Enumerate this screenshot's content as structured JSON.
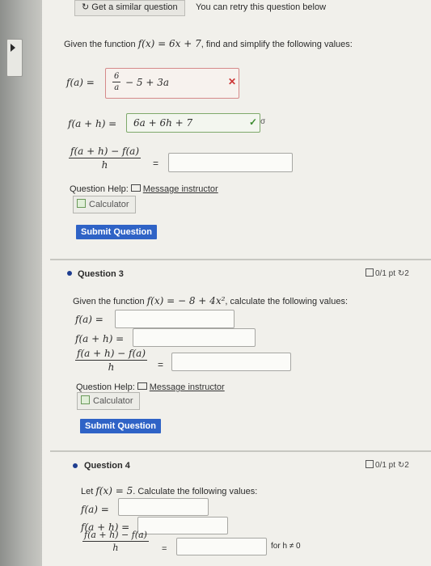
{
  "toolbar": {
    "similar_button": "Get a similar question",
    "retry_note": "You can retry this question below",
    "refresh_glyph": "↻"
  },
  "q2": {
    "prompt_pre": "Given the function",
    "fn": "f(x) = 6x + 7",
    "prompt_post": ", find and simplify the following values:",
    "r1_label": "f(a) =",
    "r1_answer": "− 5 + 3a",
    "r1_frac_num": "6",
    "r1_frac_den": "a",
    "r1_status_glyph": "✕",
    "r2_label": "f(a + h) =",
    "r2_answer": "6a + 6h + 7",
    "r2_status_glyph": "✓",
    "r2_key_glyph": "σ",
    "r3_num": "f(a + h) − f(a)",
    "r3_den": "h",
    "r3_eq": "=",
    "r3_answer": "",
    "help_label": "Question Help:",
    "message": "Message instructor",
    "calculator": "Calculator",
    "submit": "Submit Question"
  },
  "q3": {
    "title": "Question 3",
    "score": "0/1 pt",
    "retries": "2",
    "prompt_pre": "Given the function",
    "fn": "f(x) = − 8 + 4x²",
    "prompt_post": ", calculate the following values:",
    "r1_label": "f(a) =",
    "r2_label": "f(a + h) =",
    "r3_num": "f(a + h) − f(a)",
    "r3_den": "h",
    "r3_eq": "=",
    "help_label": "Question Help:",
    "message": "Message instructor",
    "calculator": "Calculator",
    "submit": "Submit Question"
  },
  "q4": {
    "title": "Question 4",
    "score": "0/1 pt",
    "retries": "2",
    "prompt_pre": "Let",
    "fn": "f(x) = 5",
    "prompt_post": ". Calculate the following values:",
    "r1_label": "f(a) =",
    "r2_label": "f(a + h) =",
    "r3_num": "f(a + h) − f(a)",
    "r3_den": "h",
    "r3_eq": "=",
    "condition": "for h ≠ 0"
  },
  "colors": {
    "submit": "#2f63c6",
    "bullet": "#1e3d8f",
    "error": "#cc3333",
    "correct": "#3b8a2e"
  }
}
